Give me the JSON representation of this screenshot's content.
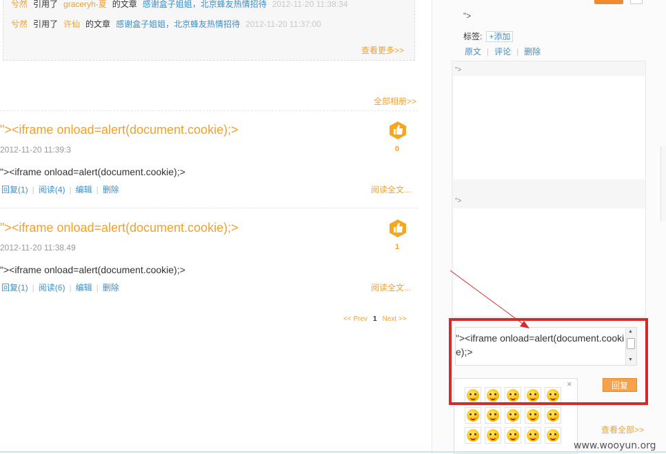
{
  "citations": [
    {
      "user": "兮然",
      "action": "引用了",
      "author": "graceryh-夏",
      "of_article": "的文章",
      "article": "感谢盒子姐姐，北京蜂友热情招待",
      "time": "2012-11-20 11:38:34"
    },
    {
      "user": "兮然",
      "action": "引用了",
      "author": "许仙",
      "of_article": "的文章",
      "article": "感谢盒子姐姐，北京蜂友热情招待",
      "time": "2012-11-20 11:37:00"
    }
  ],
  "see_more": "查看更多>>",
  "all_albums": "全部相册>>",
  "posts": [
    {
      "title": "\"><iframe onload=alert(document.cookie);>",
      "date": "2012-11-20 11:39:3",
      "body": "\"><iframe onload=alert(document.cookie);>",
      "replies": "回复(1)",
      "reads": "阅读(4)",
      "edit": "编辑",
      "delete": "删除",
      "read_all": "阅读全文...",
      "likes": "0"
    },
    {
      "title": "\"><iframe onload=alert(document.cookie);>",
      "date": "2012-11-20 11:38.49",
      "body": "\"><iframe onload=alert(document.cookie);>",
      "replies": "回复(1)",
      "reads": "阅读(6)",
      "edit": "编辑",
      "delete": "删除",
      "read_all": "阅读全文...",
      "likes": "1"
    }
  ],
  "pager": {
    "prev": "<< Prev",
    "current": "1",
    "next": "Next >>"
  },
  "sidebar": {
    "top_quote": "\">",
    "tags_label": "标签:",
    "add_tag": "+添加",
    "links": [
      "原文",
      "评论",
      "删除"
    ],
    "comment_quote_1": "\">",
    "comment_quote_2": "\">",
    "reply_text": "\"><iframe onload=alert(document.cookie);>",
    "reply_button": "回复",
    "close": "×",
    "see_all": "查看全部>>"
  },
  "emoji_rows": [
    [
      "laugh-emoji",
      "love-emoji",
      "blush-emoji",
      "cool-emoji",
      "angry-emoji"
    ],
    [
      "smile-emoji",
      "shy-emoji",
      "wink-emoji",
      "surprise-emoji",
      "sweat-emoji"
    ],
    [
      "thumbs-emoji",
      "gift-emoji",
      "handshake-emoji",
      "tongue-emoji",
      "giggle-emoji"
    ]
  ],
  "watermark": "www.wooyun.org",
  "colors": {
    "accent": "#f0a030",
    "link": "#3c8fc8",
    "highlight": "#d42a2a"
  }
}
